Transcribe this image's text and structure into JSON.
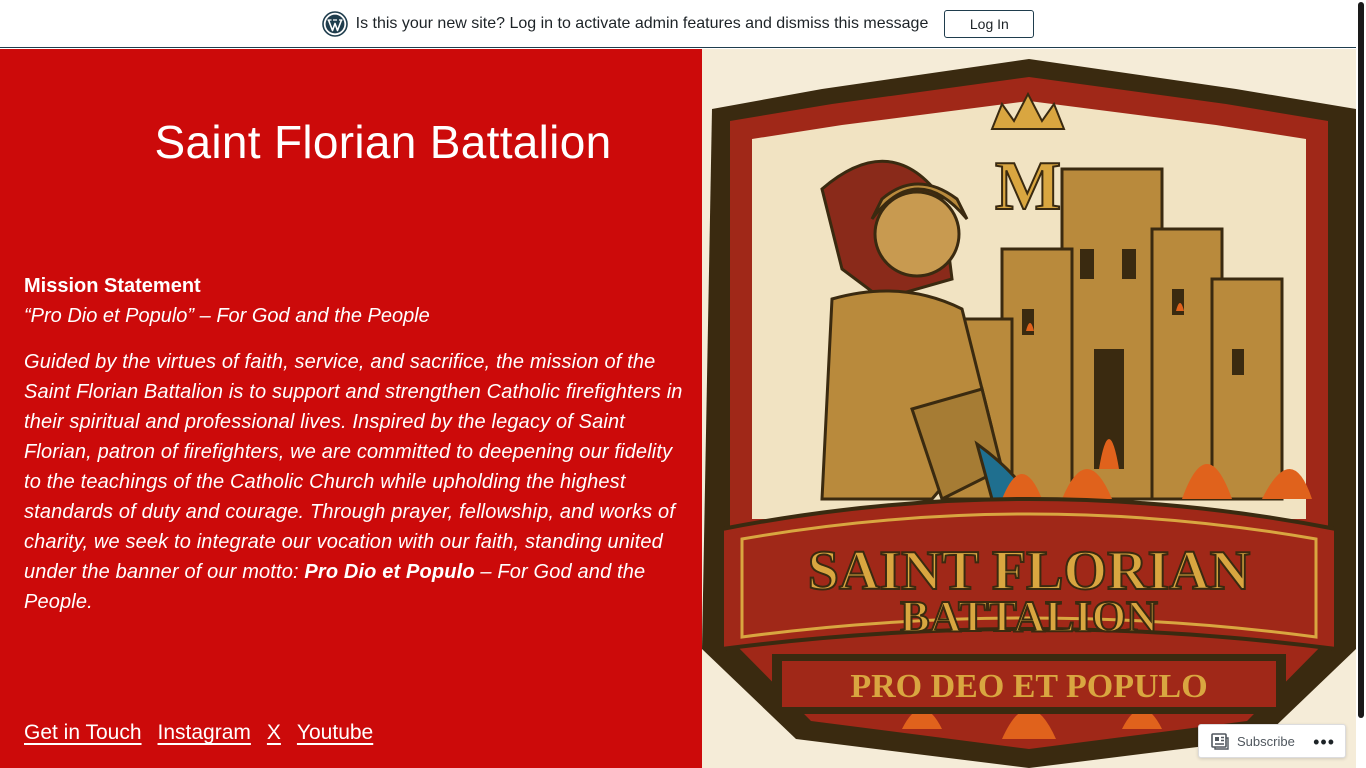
{
  "notice": {
    "message": "Is this your new site? Log in to activate admin features and dismiss this message",
    "login_label": "Log In"
  },
  "site": {
    "title": "Saint Florian Battalion"
  },
  "mission": {
    "heading": "Mission Statement",
    "motto_line": "“Pro Dio et Populo” – For God and the People",
    "body_start": "Guided by the virtues of faith, service, and sacrifice, the mission of the Saint Florian Battalion is to support and strengthen Catholic firefighters in their spiritual and professional lives. Inspired by the legacy of Saint Florian, patron of firefighters, we are committed to deepening our fidelity to the teachings of the Catholic Church while upholding the highest standards of duty and courage. Through prayer, fellowship, and works of charity, we seek to integrate our vocation with our faith, standing united under the banner of our motto: ",
    "body_motto": "Pro Dio et Populo",
    "body_end": " – For God and the People."
  },
  "footer": {
    "links": [
      "Get in Touch",
      "Instagram",
      "X",
      "Youtube"
    ]
  },
  "emblem": {
    "line1": "SAINT FLORIAN",
    "line2": "BATTALION",
    "line3": "PRO DEO ET POPULO",
    "monogram": "M"
  },
  "subscribe": {
    "label": "Subscribe"
  },
  "colors": {
    "panel_red": "#cc0a0a",
    "emblem_red": "#a02818",
    "emblem_gold": "#d9a640",
    "emblem_dark": "#3a2a10"
  }
}
